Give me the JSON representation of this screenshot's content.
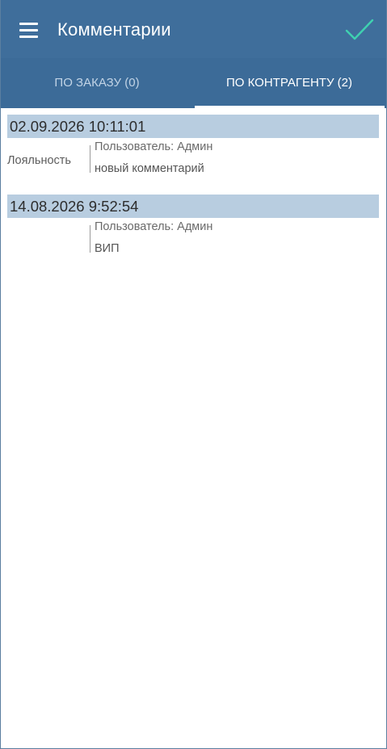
{
  "header": {
    "title": "Комментарии",
    "menu_icon": "hamburger-menu-icon",
    "confirm_icon": "checkmark-icon",
    "confirm_color": "#3fd1b0",
    "background": "#3f6e9b"
  },
  "tabs": [
    {
      "label": "ПО ЗАКАЗУ (0)",
      "active": false
    },
    {
      "label": "ПО КОНТРАГЕНТУ (2)",
      "active": true
    }
  ],
  "comments": [
    {
      "datetime": "02.09.2026 10:11:01",
      "category": "Лояльность",
      "user": "Пользователь: Админ",
      "text": "новый комментарий"
    },
    {
      "datetime": "14.08.2026 9:52:54",
      "category": "",
      "user": "Пользователь: Админ",
      "text": "ВИП"
    }
  ]
}
